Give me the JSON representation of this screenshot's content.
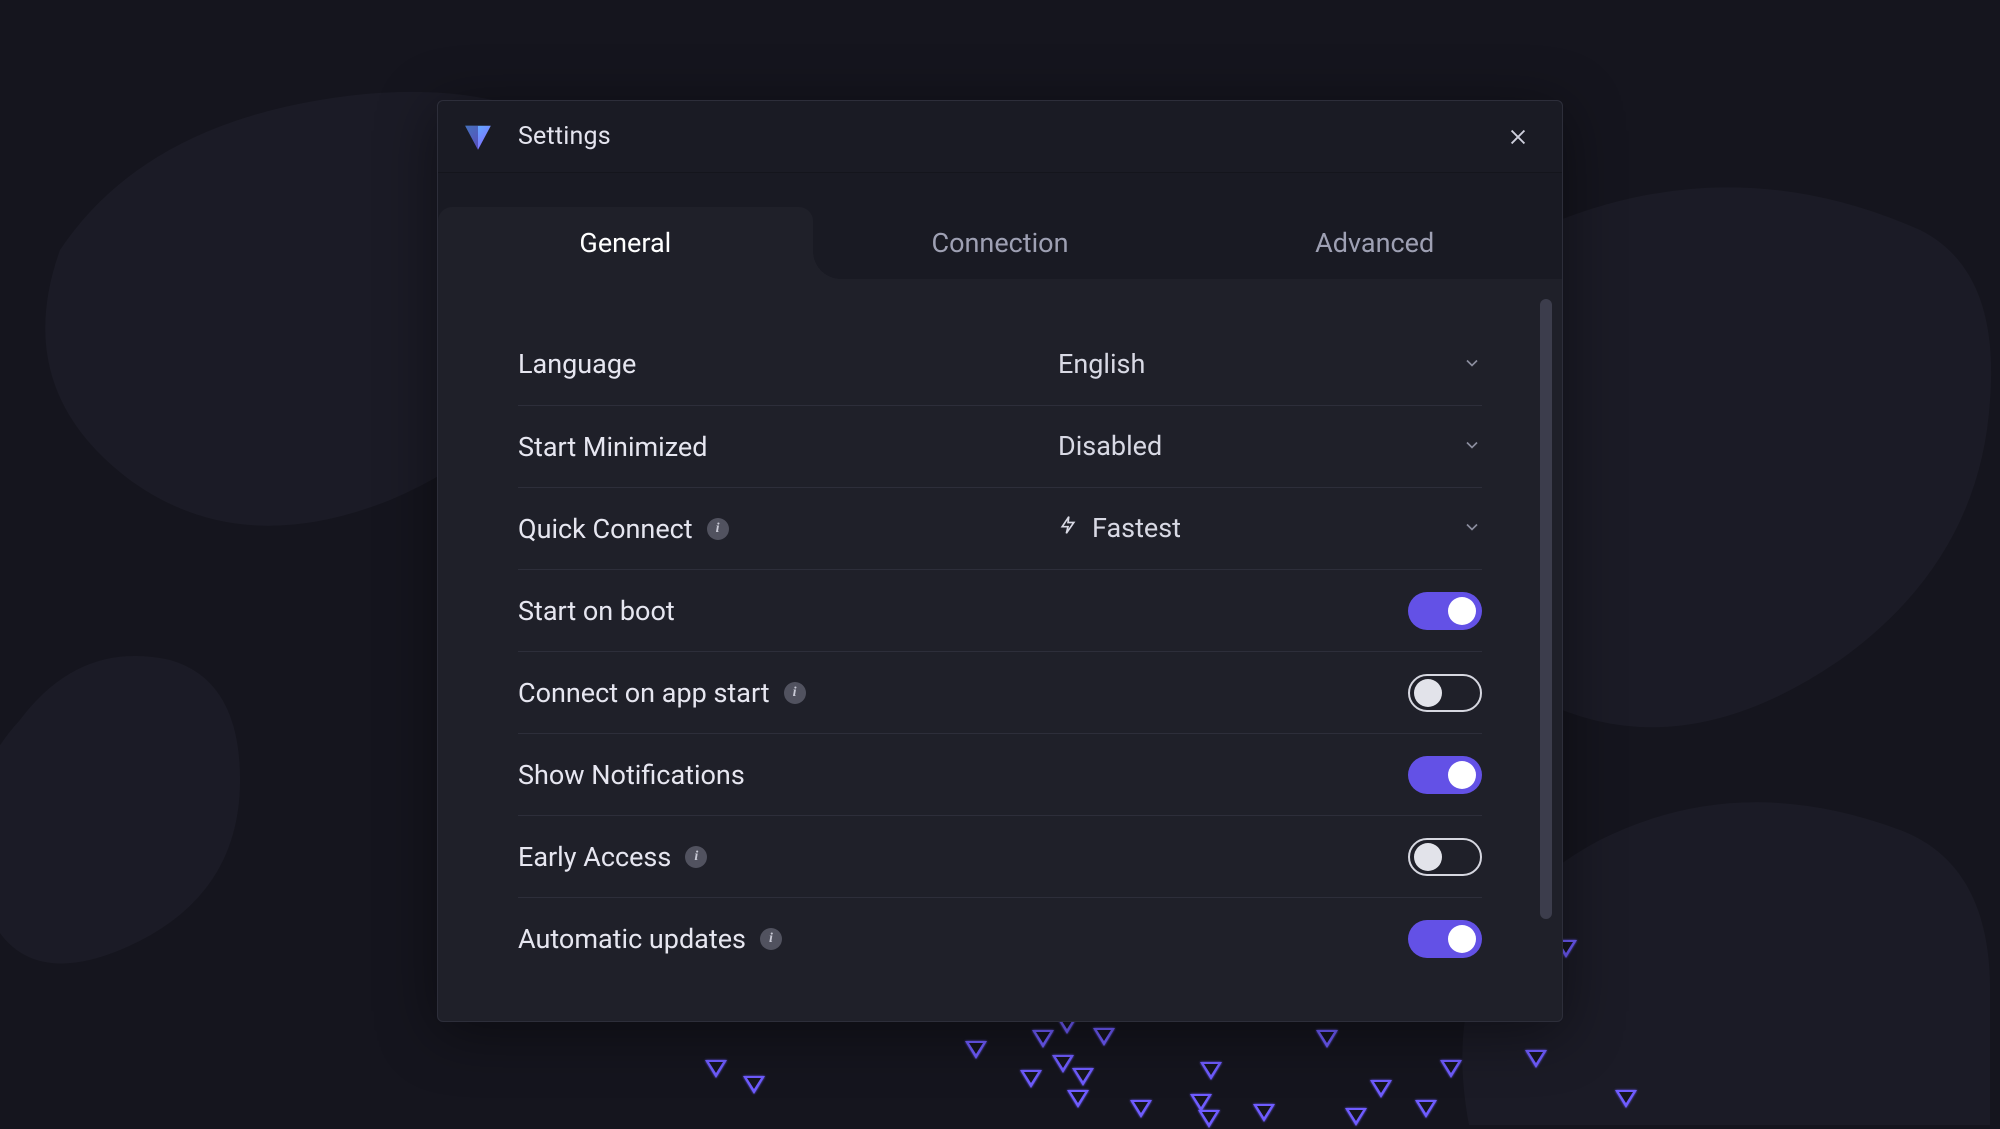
{
  "window": {
    "title": "Settings"
  },
  "tabs": [
    {
      "label": "General",
      "active": true
    },
    {
      "label": "Connection",
      "active": false
    },
    {
      "label": "Advanced",
      "active": false
    }
  ],
  "settings": {
    "language": {
      "label": "Language",
      "value": "English",
      "info": false
    },
    "start_minimized": {
      "label": "Start Minimized",
      "value": "Disabled",
      "info": false
    },
    "quick_connect": {
      "label": "Quick Connect",
      "value": "Fastest",
      "info": true,
      "icon": "bolt"
    },
    "start_on_boot": {
      "label": "Start on boot",
      "on": true,
      "info": false
    },
    "connect_on_start": {
      "label": "Connect on app start",
      "on": false,
      "info": true
    },
    "show_notifs": {
      "label": "Show Notifications",
      "on": true,
      "info": false
    },
    "early_access": {
      "label": "Early Access",
      "on": false,
      "info": true
    },
    "auto_updates": {
      "label": "Automatic updates",
      "on": true,
      "info": true
    }
  },
  "colors": {
    "accent": "#6351e6"
  }
}
